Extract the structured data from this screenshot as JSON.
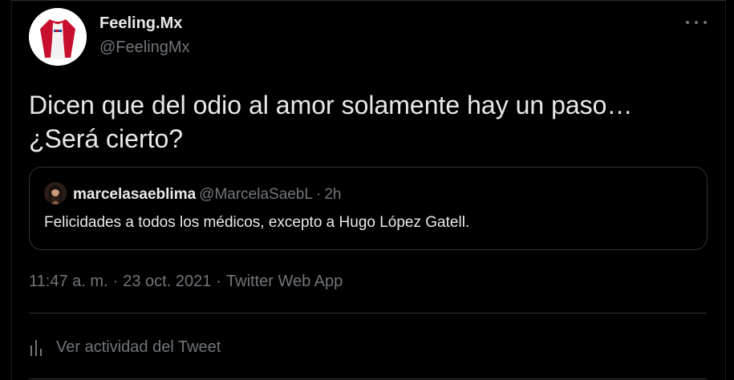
{
  "tweet": {
    "author_name": "Feeling.Mx",
    "author_handle": "@FeelingMx",
    "more_icon": "more-horizontal-icon",
    "text_lines": [
      "Dicen que del odio al amor solamente hay un paso…",
      "¿Será cierto?"
    ],
    "timestamp": "11:47 a. m.",
    "date": "23 oct. 2021",
    "separator": "·",
    "source": "Twitter Web App",
    "activity_label": "Ver actividad del Tweet",
    "activity_icon": "analytics-bars-icon"
  },
  "quote": {
    "author_name": "marcelasaeblima",
    "author_handle": "@MarcelaSaebL",
    "separator": "·",
    "time": "2h",
    "text": "Felicidades a todos los médicos, excepto a Hugo López Gatell."
  },
  "colors": {
    "background": "#000000",
    "primary_text": "#e7e9ea",
    "secondary_text": "#71767b",
    "border": "#2f3336"
  }
}
